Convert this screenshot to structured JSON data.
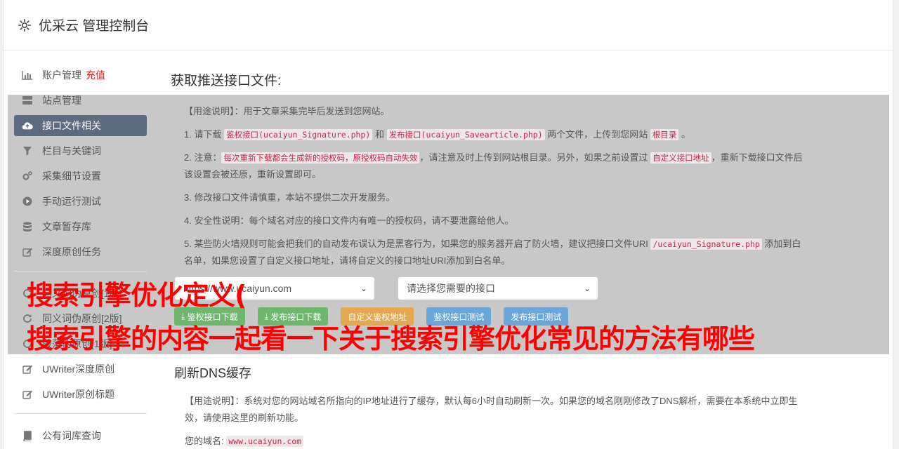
{
  "header": {
    "title": "优采云 管理控制台"
  },
  "sidebar": {
    "items": [
      {
        "label": "账户管理",
        "extra": "充值"
      },
      {
        "label": "站点管理"
      },
      {
        "label": "接口文件相关"
      },
      {
        "label": "栏目与关键词"
      },
      {
        "label": "采集细节设置"
      },
      {
        "label": "手动运行测试"
      },
      {
        "label": "文章暂存库"
      },
      {
        "label": "深度原创任务"
      },
      {
        "label": "同义词伪原创[1版]"
      },
      {
        "label": "同义词伪原创[2版]"
      },
      {
        "label": "段落伪原创[1版]"
      },
      {
        "label": "UWriter深度原创"
      },
      {
        "label": "UWriter原创标题"
      },
      {
        "label": "公有词库查询"
      }
    ]
  },
  "main": {
    "title": "获取推送接口文件:",
    "usage_label": "【用途说明】",
    "usage_text": "：用于文章采集完毕后发送到您网站。",
    "step1_a": "1. 请下载 ",
    "step1_code1": "鉴权接口(ucaiyun_Signature.php)",
    "step1_b": " 和 ",
    "step1_code2": "发布接口(ucaiyun_Savearticle.php)",
    "step1_c": " 两个文件，上传到您网站 ",
    "step1_code3": "根目录",
    "step1_d": " 。",
    "step2_a": "2. 注意：",
    "step2_code1": "每次重新下载都会生成新的授权码，原授权码自动失效",
    "step2_b": "，请注意及时上传到网站根目录。另外，如果之前设置过 ",
    "step2_code2": "自定义接口地址",
    "step2_c": "，重新下载接口文件后该设置会被还原，重新设置即可。",
    "step3": "3. 修改接口文件请慎重，本站不提供二次开发服务。",
    "step4": "4. 安全性说明：每个域名对应的接口文件内有唯一的授权码，请不要泄露给他人。",
    "step5_a": "5. 某些防火墙规则可能会把我们的自动发布误认为是黑客行为，如果您的服务器开启了防火墙，建议把接口文件URI ",
    "step5_code": "/ucaiyun_Signature.php",
    "step5_b": " 添加到白名单，如果您设置了自定义接口地址，请将自定义的接口地址URI添加到白名单。",
    "select_site": "https://www.ucaiyun.com",
    "select_api": "请选择您需要的接口",
    "btn_sig": "鉴权接口下载",
    "btn_pub": "发布接口下载",
    "btn_custom": "自定义鉴权地址",
    "btn_sig_test": "鉴权接口测试",
    "btn_pub_test": "发布接口测试"
  },
  "dns": {
    "title": "刷新DNS缓存",
    "usage_label": "【用途说明】",
    "usage_text": "：系统对您的网站域名所指向的IP地址进行了缓存，默认每6小时自动刷新一次。如果您的域名刚刚修改了DNS解析，需要在本系统中立即生效，请使用这里的刷新功能。",
    "domain_label": "您的域名:",
    "domain_value": "www.ucaiyun.com"
  },
  "overlay": {
    "line1": "搜索引擎优化定义(",
    "line2": "搜索引擎的内容一起看一下关于搜索引擎优化常见的方法有哪些"
  }
}
